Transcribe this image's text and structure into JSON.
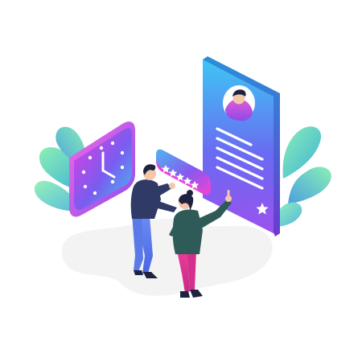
{
  "illustration": {
    "subject": "isometric-review-rating",
    "rating": {
      "stars_filled": 5,
      "stars_total": 5
    },
    "colors": {
      "gradient_blue": "#3ec6f4",
      "gradient_mid": "#7a5cf0",
      "gradient_pink": "#e43de0",
      "leaf_green": "#6fe3a6",
      "leaf_teal": "#4fb8d6",
      "floor_grey": "#f2f2f2",
      "person_navy": "#2f3a66",
      "person_dark": "#1f2340",
      "skin": "#f4c7a8",
      "pants_blue": "#5b7df2",
      "pants_pink": "#e8318f",
      "shirt_green": "#2e5a58",
      "white": "#ffffff"
    },
    "icons": [
      "clock-icon",
      "profile-avatar-icon",
      "star-icon",
      "leaf-icon"
    ]
  }
}
